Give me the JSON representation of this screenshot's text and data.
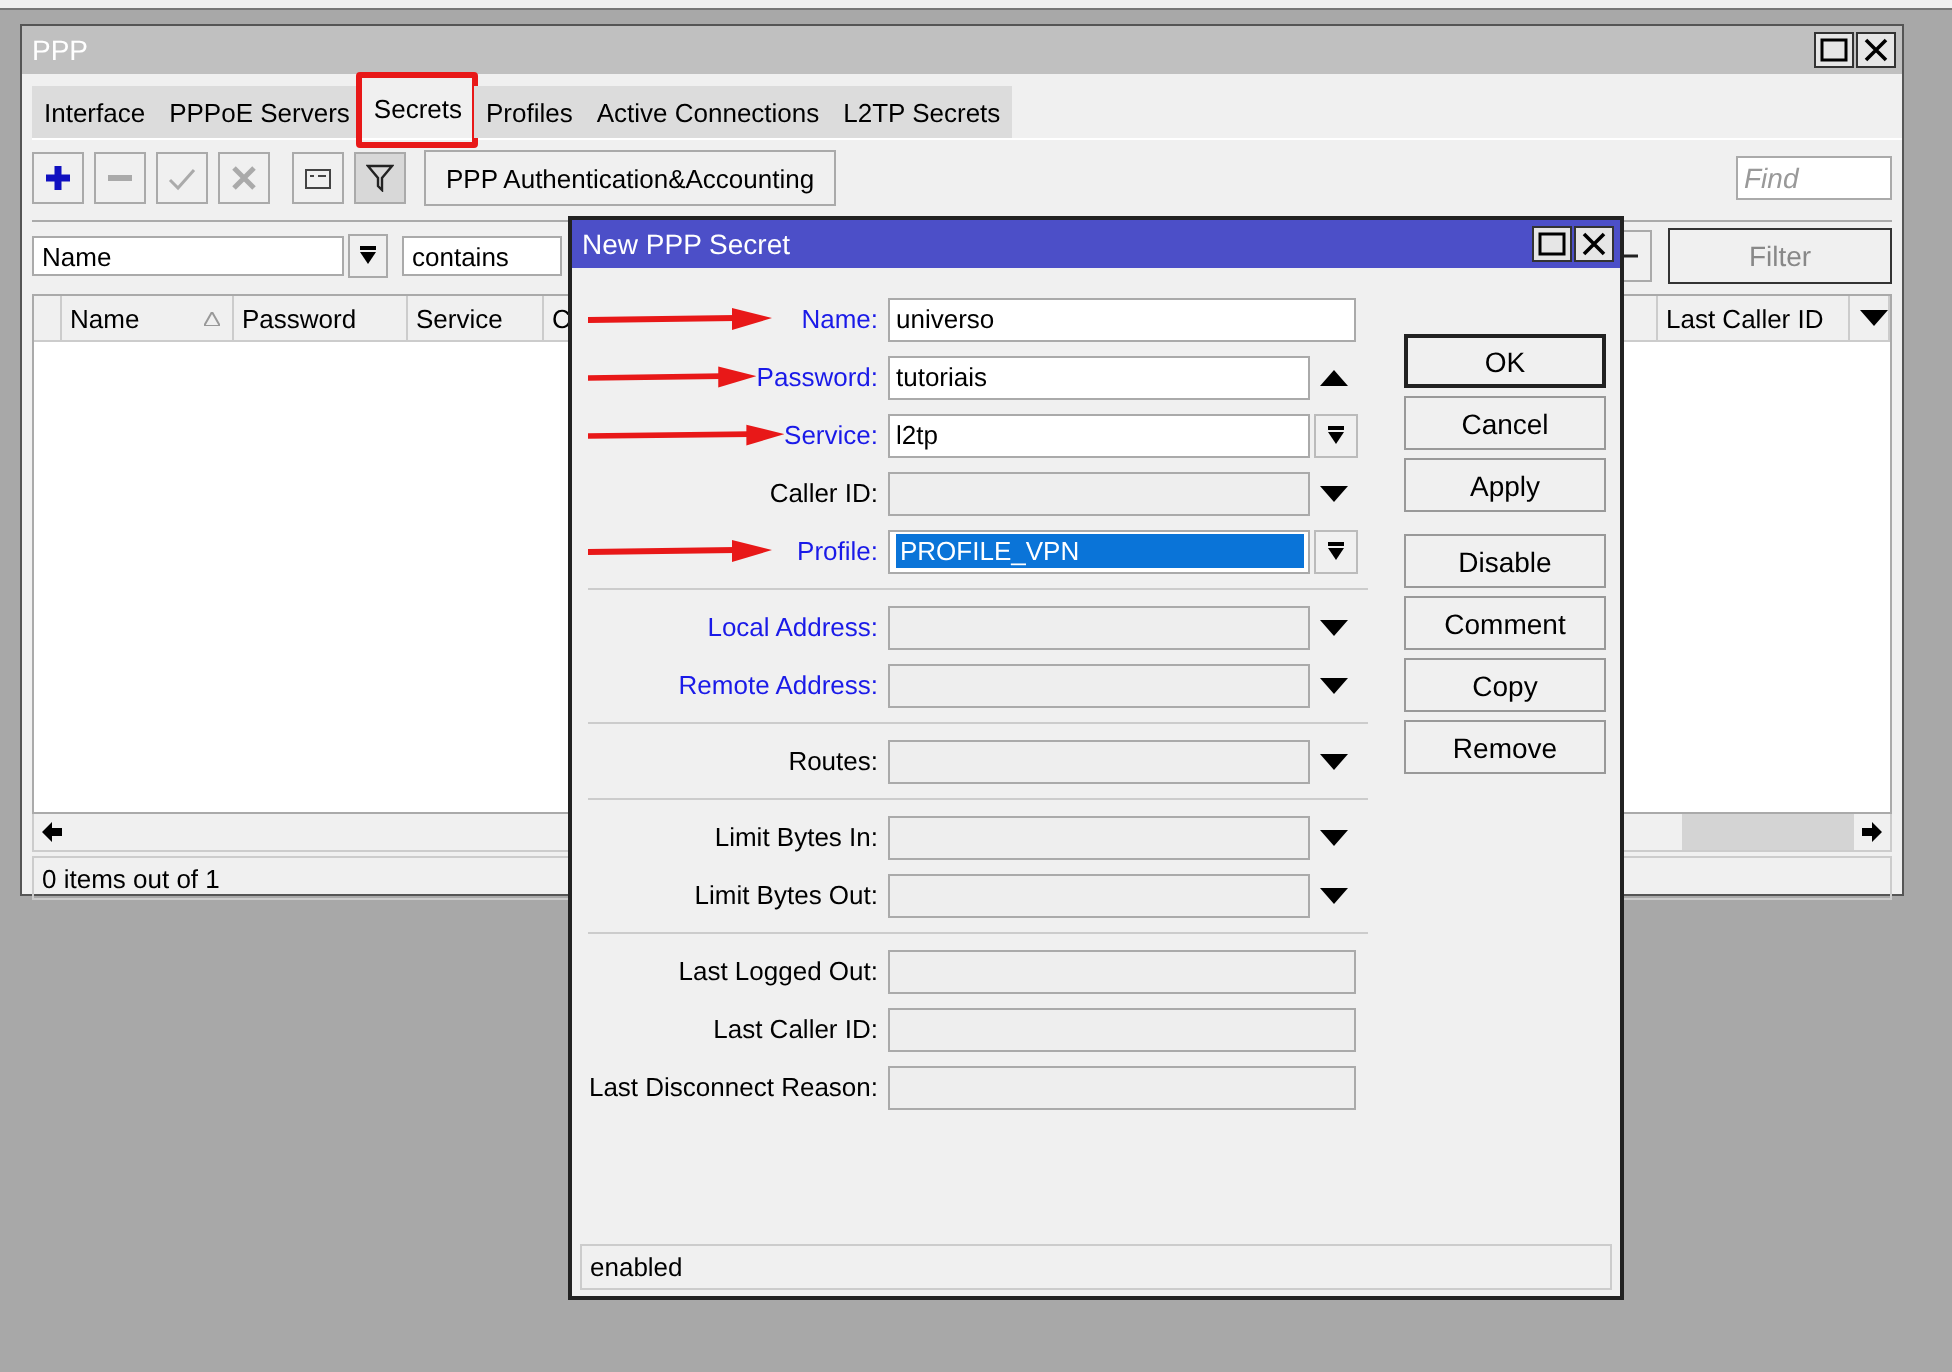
{
  "window": {
    "title": "PPP"
  },
  "tabs": [
    {
      "label": "Interface",
      "selected": false,
      "annotated": false
    },
    {
      "label": "PPPoE Servers",
      "selected": false,
      "annotated": false
    },
    {
      "label": "Secrets",
      "selected": true,
      "annotated": true
    },
    {
      "label": "Profiles",
      "selected": false,
      "annotated": false
    },
    {
      "label": "Active Connections",
      "selected": false,
      "annotated": false
    },
    {
      "label": "L2TP Secrets",
      "selected": false,
      "annotated": false
    }
  ],
  "toolbar": {
    "buttons": [
      {
        "kind": "add",
        "disabled": false
      },
      {
        "kind": "remove",
        "disabled": true
      },
      {
        "kind": "enable",
        "disabled": true
      },
      {
        "kind": "disable",
        "disabled": true
      },
      {
        "kind": "comment",
        "disabled": false
      },
      {
        "kind": "filter",
        "disabled": false,
        "pressed": true
      }
    ],
    "text_button": "PPP Authentication&Accounting",
    "find": {
      "placeholder": "Find"
    }
  },
  "filter_bar": {
    "field": "Name",
    "operator": "contains",
    "button": "Filter"
  },
  "table": {
    "columns": [
      {
        "label": "Name",
        "sorted": true
      },
      {
        "label": "Password",
        "sorted": false
      },
      {
        "label": "Service",
        "sorted": false
      },
      {
        "label": "C",
        "sorted": false
      },
      {
        "label": "Last Caller ID",
        "sorted": false
      }
    ]
  },
  "status_bar": "0 items out of 1",
  "dialog": {
    "title": "New PPP Secret",
    "groups": [
      [
        {
          "label": "Name:",
          "kind": "text",
          "value": "universo",
          "editable": true,
          "highlighted": true,
          "arrow": true,
          "text_selected": false
        },
        {
          "label": "Password:",
          "kind": "password",
          "value": "tutoriais",
          "editable": true,
          "highlighted": true,
          "arrow": true,
          "text_selected": false
        },
        {
          "label": "Service:",
          "kind": "select",
          "value": "l2tp",
          "editable": true,
          "highlighted": true,
          "arrow": true,
          "text_selected": false
        },
        {
          "label": "Caller ID:",
          "kind": "combo",
          "editable": false,
          "highlighted": false,
          "arrow": false
        },
        {
          "label": "Profile:",
          "kind": "select",
          "value": "PROFILE_VPN",
          "editable": true,
          "highlighted": true,
          "arrow": true,
          "text_selected": true
        }
      ],
      [
        {
          "label": "Local Address:",
          "kind": "combo",
          "editable": false,
          "highlighted": true,
          "arrow": false
        },
        {
          "label": "Remote Address:",
          "kind": "combo",
          "editable": false,
          "highlighted": true,
          "arrow": false
        }
      ],
      [
        {
          "label": "Routes:",
          "kind": "combo",
          "editable": false,
          "highlighted": false,
          "arrow": false
        }
      ],
      [
        {
          "label": "Limit Bytes In:",
          "kind": "combo",
          "editable": false,
          "highlighted": false,
          "arrow": false
        },
        {
          "label": "Limit Bytes Out:",
          "kind": "combo",
          "editable": false,
          "highlighted": false,
          "arrow": false
        }
      ],
      [
        {
          "label": "Last Logged Out:",
          "kind": "readonly",
          "editable": false,
          "highlighted": false,
          "arrow": false
        },
        {
          "label": "Last Caller ID:",
          "kind": "readonly",
          "editable": false,
          "highlighted": false,
          "arrow": false
        },
        {
          "label": "Last Disconnect Reason:",
          "kind": "readonly",
          "editable": false,
          "highlighted": false,
          "arrow": false
        }
      ]
    ],
    "button_groups": [
      [
        {
          "label": "OK",
          "default": true
        },
        {
          "label": "Cancel",
          "default": false
        },
        {
          "label": "Apply",
          "default": false
        }
      ],
      [
        {
          "label": "Disable",
          "default": false
        },
        {
          "label": "Comment",
          "default": false
        },
        {
          "label": "Copy",
          "default": false
        },
        {
          "label": "Remove",
          "default": false
        }
      ]
    ],
    "status": "enabled"
  }
}
